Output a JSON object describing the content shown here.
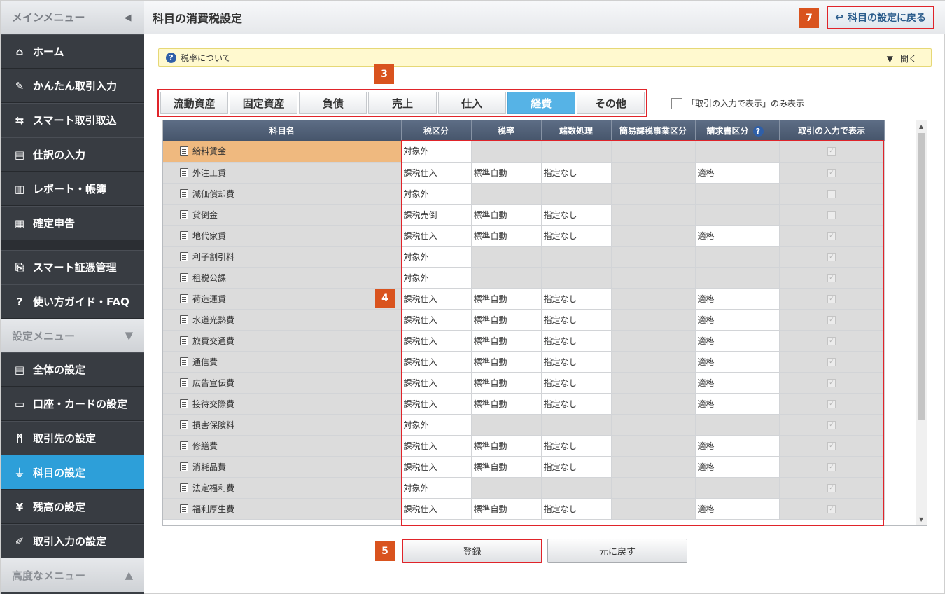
{
  "sidebar": {
    "main_menu_label": "メインメニュー",
    "items": [
      {
        "label": "ホーム",
        "icon": "home-icon",
        "glyph": "⌂"
      },
      {
        "label": "かんたん取引入力",
        "icon": "pencil-icon",
        "glyph": "✎"
      },
      {
        "label": "スマート取引取込",
        "icon": "import-icon",
        "glyph": "⇆"
      },
      {
        "label": "仕訳の入力",
        "icon": "journal-icon",
        "glyph": "▤"
      },
      {
        "label": "レポート・帳簿",
        "icon": "chart-icon",
        "glyph": "▥"
      },
      {
        "label": "確定申告",
        "icon": "building-icon",
        "glyph": "▦"
      }
    ],
    "items2": [
      {
        "label": "スマート証憑管理",
        "icon": "document-icon",
        "glyph": "⎘"
      },
      {
        "label": "使い方ガイド・FAQ",
        "icon": "help-icon",
        "glyph": "?"
      }
    ],
    "settings_menu_label": "設定メニュー",
    "settings_items": [
      {
        "label": "全体の設定",
        "icon": "settings-doc-icon",
        "glyph": "▤"
      },
      {
        "label": "口座・カードの設定",
        "icon": "card-icon",
        "glyph": "▭"
      },
      {
        "label": "取引先の設定",
        "icon": "people-icon",
        "glyph": "ᛗ"
      },
      {
        "label": "科目の設定",
        "icon": "tree-icon",
        "glyph": "⏚",
        "active": true
      },
      {
        "label": "残高の設定",
        "icon": "yen-icon",
        "glyph": "¥"
      },
      {
        "label": "取引入力の設定",
        "icon": "wrench-icon",
        "glyph": "✐"
      }
    ],
    "advanced_menu_label": "高度なメニュー"
  },
  "header": {
    "title": "科目の消費税設定",
    "back_label": "科目の設定に戻る",
    "back_marker": "7"
  },
  "info": {
    "text": "税率について",
    "open_label": "開く"
  },
  "markers": {
    "tabs": "3",
    "table": "4",
    "register": "5"
  },
  "tabs": [
    {
      "label": "流動資産"
    },
    {
      "label": "固定資産"
    },
    {
      "label": "負債"
    },
    {
      "label": "売上"
    },
    {
      "label": "仕入"
    },
    {
      "label": "経費",
      "active": true
    },
    {
      "label": "その他"
    }
  ],
  "filter_label": "「取引の入力で表示」のみ表示",
  "table": {
    "headers": [
      "科目名",
      "税区分",
      "税率",
      "端数処理",
      "簡易課税事業区分",
      "請求書区分",
      "取引の入力で表示"
    ],
    "rows": [
      {
        "name": "給料賃金",
        "tax": "対象外",
        "rate": "",
        "round": "",
        "simple": "",
        "invoice": "",
        "show": true,
        "sel": true
      },
      {
        "name": "外注工賃",
        "tax": "課税仕入",
        "rate": "標準自動",
        "round": "指定なし",
        "simple": "",
        "invoice": "適格",
        "show": true
      },
      {
        "name": "減価償却費",
        "tax": "対象外",
        "rate": "",
        "round": "",
        "simple": "",
        "invoice": "",
        "show": false
      },
      {
        "name": "貸倒金",
        "tax": "課税売倒",
        "rate": "標準自動",
        "round": "指定なし",
        "simple": "",
        "invoice": "",
        "show": false
      },
      {
        "name": "地代家賃",
        "tax": "課税仕入",
        "rate": "標準自動",
        "round": "指定なし",
        "simple": "",
        "invoice": "適格",
        "show": true
      },
      {
        "name": "利子割引料",
        "tax": "対象外",
        "rate": "",
        "round": "",
        "simple": "",
        "invoice": "",
        "show": true
      },
      {
        "name": "租税公課",
        "tax": "対象外",
        "rate": "",
        "round": "",
        "simple": "",
        "invoice": "",
        "show": true
      },
      {
        "name": "荷造運賃",
        "tax": "課税仕入",
        "rate": "標準自動",
        "round": "指定なし",
        "simple": "",
        "invoice": "適格",
        "show": true
      },
      {
        "name": "水道光熱費",
        "tax": "課税仕入",
        "rate": "標準自動",
        "round": "指定なし",
        "simple": "",
        "invoice": "適格",
        "show": true
      },
      {
        "name": "旅費交通費",
        "tax": "課税仕入",
        "rate": "標準自動",
        "round": "指定なし",
        "simple": "",
        "invoice": "適格",
        "show": true
      },
      {
        "name": "通信費",
        "tax": "課税仕入",
        "rate": "標準自動",
        "round": "指定なし",
        "simple": "",
        "invoice": "適格",
        "show": true
      },
      {
        "name": "広告宣伝費",
        "tax": "課税仕入",
        "rate": "標準自動",
        "round": "指定なし",
        "simple": "",
        "invoice": "適格",
        "show": true
      },
      {
        "name": "接待交際費",
        "tax": "課税仕入",
        "rate": "標準自動",
        "round": "指定なし",
        "simple": "",
        "invoice": "適格",
        "show": true
      },
      {
        "name": "損害保険料",
        "tax": "対象外",
        "rate": "",
        "round": "",
        "simple": "",
        "invoice": "",
        "show": true
      },
      {
        "name": "修繕費",
        "tax": "課税仕入",
        "rate": "標準自動",
        "round": "指定なし",
        "simple": "",
        "invoice": "適格",
        "show": true
      },
      {
        "name": "消耗品費",
        "tax": "課税仕入",
        "rate": "標準自動",
        "round": "指定なし",
        "simple": "",
        "invoice": "適格",
        "show": true
      },
      {
        "name": "法定福利費",
        "tax": "対象外",
        "rate": "",
        "round": "",
        "simple": "",
        "invoice": "",
        "show": true
      },
      {
        "name": "福利厚生費",
        "tax": "課税仕入",
        "rate": "標準自動",
        "round": "指定なし",
        "simple": "",
        "invoice": "適格",
        "show": true
      }
    ]
  },
  "buttons": {
    "register": "登録",
    "reset": "元に戻す"
  }
}
